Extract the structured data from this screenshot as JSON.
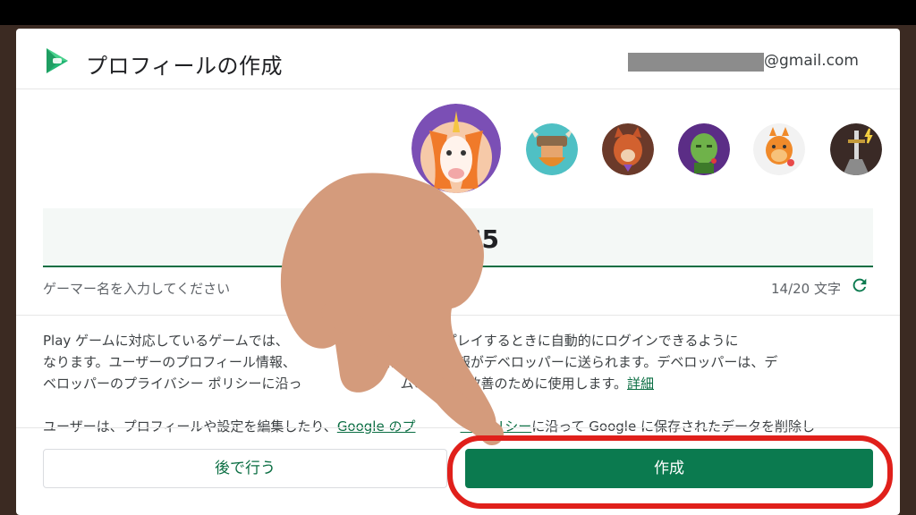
{
  "header": {
    "title": "プロフィールの作成",
    "email_suffix": "@gmail.com"
  },
  "avatars": [
    {
      "name": "unicorn",
      "selected": true,
      "bg": "#7b4fb5"
    },
    {
      "name": "viking",
      "selected": false,
      "bg": "#4fc0c4"
    },
    {
      "name": "werewolf",
      "selected": false,
      "bg": "#6b3a2a"
    },
    {
      "name": "zombie",
      "selected": false,
      "bg": "#5b2d86"
    },
    {
      "name": "dragon",
      "selected": false,
      "bg": "#f2f2f2"
    },
    {
      "name": "sword",
      "selected": false,
      "bg": "#3a2a26"
    }
  ],
  "gamer_name": {
    "value": "our65",
    "helper": "ゲーマー名を入力してください",
    "counter": "14/20 文字"
  },
  "body": {
    "p1_line1": "Play ゲームに対応しているゲームでは、",
    "p1_line1b": "ます。ゲームをプレイするときに自動的にログインできるように",
    "p1_line2": "なります。ユーザーのプロフィール情報、",
    "p1_line2b": "入に関する情報がデベロッパーに送られます。デベロッパーは、デ",
    "p1_line3": "ベロッパーのプライバシー ポリシーに沿っ",
    "p1_line3b": "ムの提供や改善のために使用します。",
    "details_link": "詳細",
    "p2_start": "ユーザーは、プロフィールや設定を編集したり、",
    "p2_link": "Google のプ",
    "p2_link2": "ー ポリシー",
    "p2_end": "に沿って Google に保存されたデータを削除し"
  },
  "buttons": {
    "later": "後で行う",
    "create": "作成"
  },
  "colors": {
    "accent": "#0b7a4f",
    "annotation_red": "#e0201b",
    "hand": "#d49b7c"
  }
}
